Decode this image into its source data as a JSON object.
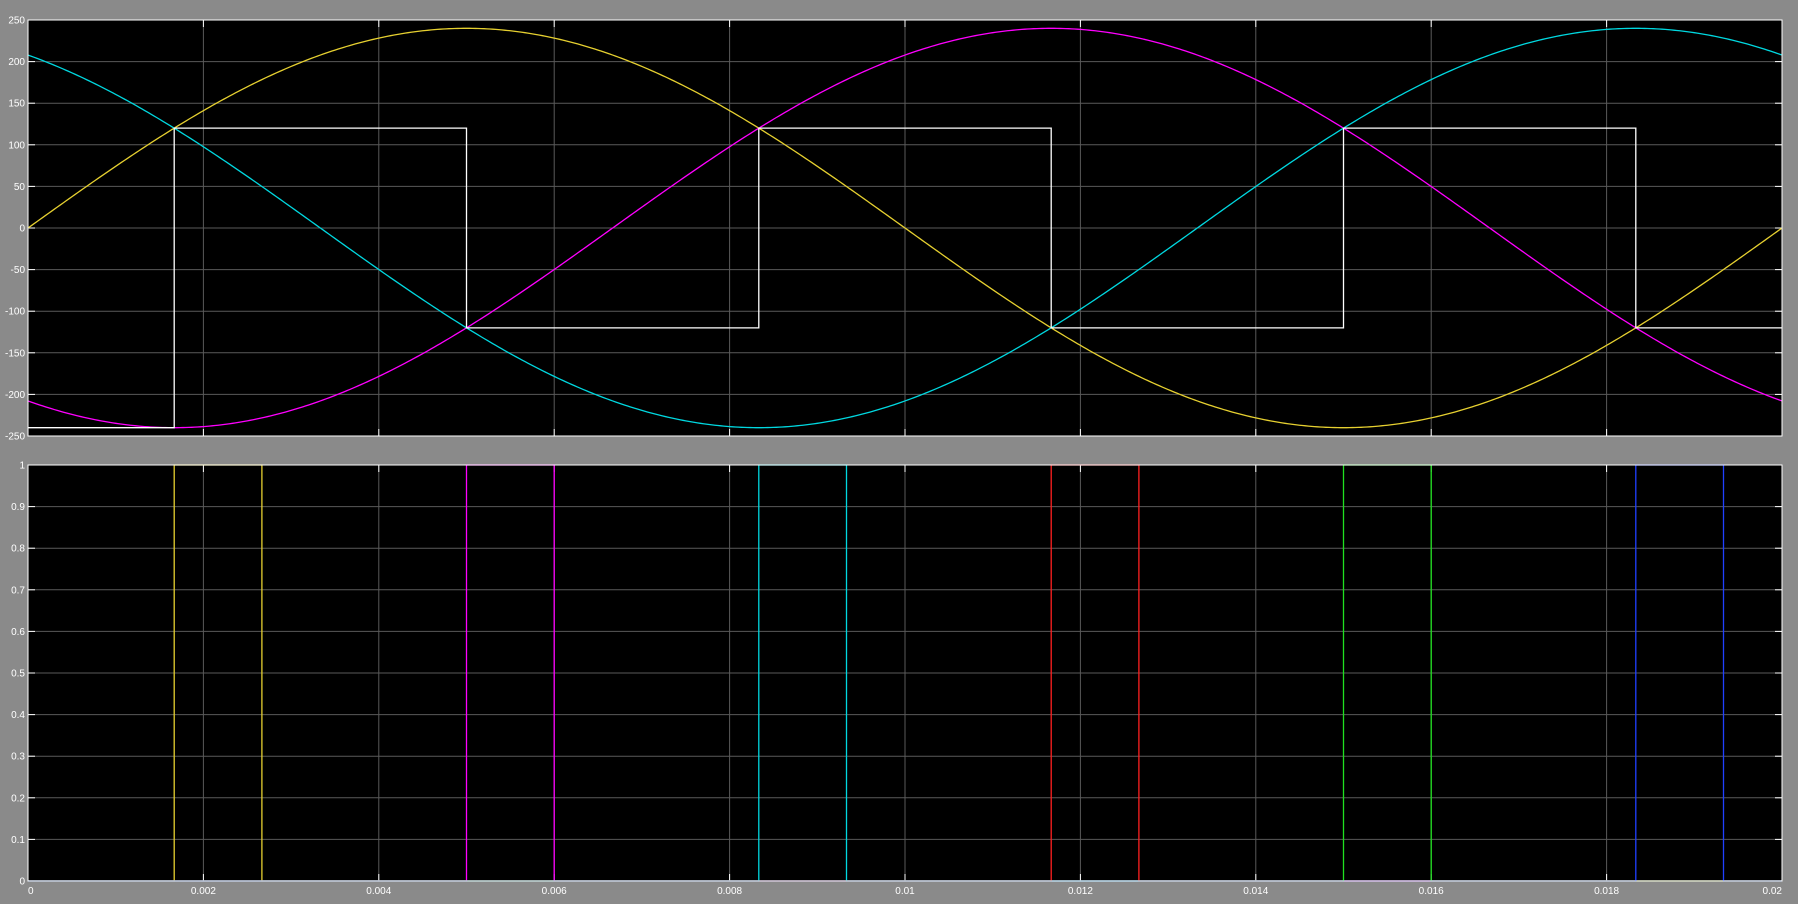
{
  "page": {
    "background": "#8a8a8a",
    "plot_background": "#000000",
    "grid_color": "#5a5a5a",
    "tick_color": "#ffffff"
  },
  "chart_data": [
    {
      "type": "line",
      "title": "",
      "xlabel": "",
      "ylabel": "",
      "xlim": [
        0,
        0.02
      ],
      "ylim": [
        -250,
        250
      ],
      "grid": true,
      "x_ticks": [
        0,
        0.002,
        0.004,
        0.006,
        0.008,
        0.01,
        0.012,
        0.014,
        0.016,
        0.018,
        0.02
      ],
      "y_ticks": [
        250,
        200,
        150,
        100,
        50,
        0,
        -50,
        -100,
        -150,
        -200,
        -250
      ],
      "y_tick_labels": [
        "250",
        "200",
        "150",
        "100",
        "50",
        "0",
        "-50",
        "-100",
        "-150",
        "-200",
        "-250"
      ],
      "series": [
        {
          "amplitude": 240,
          "frequency_hz": 50,
          "phase_deg": 0,
          "color": "#e6d030"
        },
        {
          "amplitude": 240,
          "frequency_hz": 50,
          "phase_deg": -120,
          "color": "#ff00ff"
        },
        {
          "amplitude": 240,
          "frequency_hz": 50,
          "phase_deg": 120,
          "color": "#00d8e0"
        },
        {
          "color": "#ffffff",
          "x": [
            0,
            0.001667,
            0.001667,
            0.005,
            0.005,
            0.008333,
            0.008333,
            0.011667,
            0.011667,
            0.015,
            0.015,
            0.018333,
            0.018333,
            0.02
          ],
          "y": [
            -240,
            -240,
            120,
            120,
            -120,
            -120,
            120,
            120,
            -120,
            -120,
            120,
            120,
            -120,
            -120
          ]
        }
      ]
    },
    {
      "type": "line",
      "title": "",
      "xlabel": "",
      "ylabel": "",
      "xlim": [
        0,
        0.02
      ],
      "ylim": [
        0,
        1
      ],
      "grid": true,
      "x_ticks": [
        0,
        0.002,
        0.004,
        0.006,
        0.008,
        0.01,
        0.012,
        0.014,
        0.016,
        0.018,
        0.02
      ],
      "x_tick_labels": [
        "0",
        "0.002",
        "0.004",
        "0.006",
        "0.008",
        "0.01",
        "0.012",
        "0.014",
        "0.016",
        "0.018",
        "0.02"
      ],
      "y_ticks": [
        0,
        0.1,
        0.2,
        0.3,
        0.4,
        0.5,
        0.6,
        0.7,
        0.8,
        0.9,
        1
      ],
      "y_tick_labels": [
        "0",
        "0.1",
        "0.2",
        "0.3",
        "0.4",
        "0.5",
        "0.6",
        "0.7",
        "0.8",
        "0.9",
        "1"
      ],
      "series": [
        {
          "color": "#e6d030",
          "x": [
            0,
            0.001667,
            0.001667,
            0.002667,
            0.002667,
            0.02
          ],
          "y": [
            0,
            0,
            1,
            1,
            0,
            0
          ]
        },
        {
          "color": "#ff00ff",
          "x": [
            0,
            0.005,
            0.005,
            0.006,
            0.006,
            0.02
          ],
          "y": [
            0,
            0,
            1,
            1,
            0,
            0
          ]
        },
        {
          "color": "#00d8e0",
          "x": [
            0,
            0.008333,
            0.008333,
            0.009333,
            0.009333,
            0.02
          ],
          "y": [
            0,
            0,
            1,
            1,
            0,
            0
          ]
        },
        {
          "color": "#ff2020",
          "x": [
            0,
            0.011667,
            0.011667,
            0.012667,
            0.012667,
            0.02
          ],
          "y": [
            0,
            0,
            1,
            1,
            0,
            0
          ]
        },
        {
          "color": "#20e020",
          "x": [
            0,
            0.015,
            0.015,
            0.016,
            0.016,
            0.02
          ],
          "y": [
            0,
            0,
            1,
            1,
            0,
            0
          ]
        },
        {
          "color": "#2040ff",
          "x": [
            0,
            0.018333,
            0.018333,
            0.019333,
            0.019333,
            0.02
          ],
          "y": [
            0,
            0,
            1,
            1,
            0,
            0
          ]
        }
      ]
    }
  ]
}
